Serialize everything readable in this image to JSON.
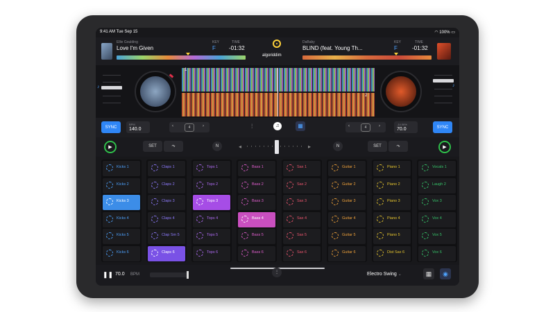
{
  "status": {
    "time": "9:41 AM",
    "date": "Tue Sep 15",
    "battery": "100%"
  },
  "deck_left": {
    "artist": "Ellie Goulding",
    "track": "Love I'm Given",
    "key_label": "KEY",
    "key": "F",
    "time_label": "TIME",
    "time": "-01:32",
    "bpm_label": "BPM",
    "bpm": "140.0",
    "loop": "4",
    "deck_num": "1"
  },
  "deck_right": {
    "artist": "DaBaby",
    "track": "BLIND (feat. Young Th...",
    "key_label": "KEY",
    "key": "F",
    "time_label": "TIME",
    "time": "-01:32",
    "pitch_label": "-14.06%",
    "bpm": "70.0",
    "loop": "4",
    "deck_num": "2"
  },
  "logo": "algoriddim",
  "sync_label": "SYNC",
  "set_label": "SET",
  "pad_columns": [
    {
      "color": "#4ea3ff",
      "active": 2,
      "active_color": "#3c8de8",
      "items": [
        "Kicks 1",
        "Kicks 2",
        "Kicks 3",
        "Kicks 4",
        "Kicks 5",
        "Kicks 6"
      ]
    },
    {
      "color": "#8f7bff",
      "active": 5,
      "active_color": "#7a52e6",
      "items": [
        "Claps 1",
        "Claps 2",
        "Claps 3",
        "Claps 4",
        "Clap Sm 5",
        "Claps 6"
      ]
    },
    {
      "color": "#b06bf5",
      "active": 2,
      "active_color": "#a64de6",
      "items": [
        "Tops 1",
        "Tops 2",
        "Tops 3",
        "Tops 4",
        "Tops 5",
        "Tops 6"
      ]
    },
    {
      "color": "#e35fd0",
      "active": 3,
      "active_color": "#c94fbf",
      "items": [
        "Bass 1",
        "Bass 2",
        "Bass 3",
        "Bass 4",
        "Bass 5",
        "Bass 6"
      ]
    },
    {
      "color": "#f0566f",
      "active": -1,
      "active_color": "",
      "items": [
        "Sax 1",
        "Sax 2",
        "Sax 3",
        "Sax 4",
        "Sax 5",
        "Sax 6"
      ]
    },
    {
      "color": "#f2a33a",
      "active": -1,
      "active_color": "",
      "items": [
        "Guitar 1",
        "Guitar 2",
        "Guitar 3",
        "Guitar 4",
        "Guitar 5",
        "Guitar 6"
      ]
    },
    {
      "color": "#e6c52e",
      "active": -1,
      "active_color": "",
      "items": [
        "Piano 1",
        "Piano 2",
        "Piano 3",
        "Piano 4",
        "Piano 5",
        "Dist Sax 6"
      ]
    },
    {
      "color": "#36c46a",
      "active": -1,
      "active_color": "",
      "items": [
        "Vocals 1",
        "Laugh 2",
        "Vox 3",
        "Vox 4",
        "Vox 5",
        "Vox 6"
      ]
    }
  ],
  "bottom": {
    "bpm": "70.0",
    "bpm_label": "BPM",
    "preset": "Electro Swing"
  },
  "colors": {
    "accent": "#2f86f6",
    "play": "#2fbf4a",
    "timeline_marker": "#ffd23a"
  }
}
